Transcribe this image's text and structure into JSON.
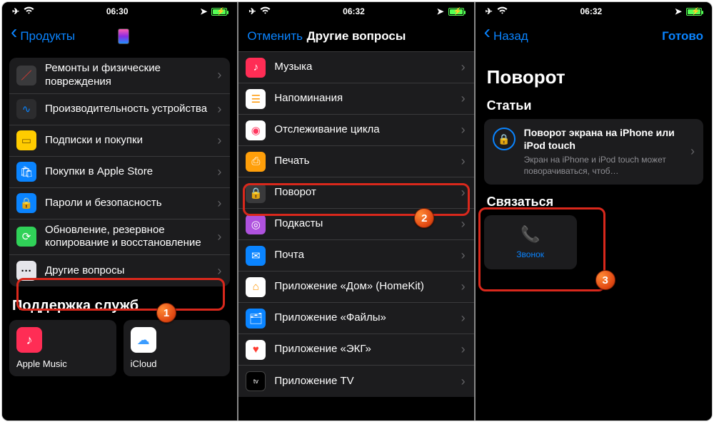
{
  "screen1": {
    "status": {
      "time": "06:30"
    },
    "back_label": "Продукты",
    "topics": [
      {
        "label": "Ремонты и физические повреждения",
        "icon": "screwdriver-icon",
        "bg": "#3a3a3c",
        "glyph": "🛠"
      },
      {
        "label": "Производительность устройства",
        "icon": "activity-icon",
        "bg": "#3a3a3c",
        "glyph": "〰"
      },
      {
        "label": "Подписки и покупки",
        "icon": "wallet-icon",
        "bg": "#ffcc00",
        "glyph": "💳"
      },
      {
        "label": "Покупки в Apple Store",
        "icon": "bag-icon",
        "bg": "#0a84ff",
        "glyph": "🛍"
      },
      {
        "label": "Пароли и безопасность",
        "icon": "lock-icon",
        "bg": "#0a84ff",
        "glyph": "🔒"
      },
      {
        "label": "Обновление, резервное копирование и восстановление",
        "icon": "backup-icon",
        "bg": "#30d158",
        "glyph": "⟳"
      },
      {
        "label": "Другие вопросы",
        "icon": "more-icon",
        "bg": "#e5e5ea",
        "glyph": "···"
      }
    ],
    "services_header": "Поддержка служб",
    "services": [
      {
        "label": "Apple Music",
        "bg": "#ff2d55",
        "glyph": "♪"
      },
      {
        "label": "iCloud",
        "bg": "#ffffff",
        "glyph": "☁"
      }
    ]
  },
  "screen2": {
    "status": {
      "time": "06:32"
    },
    "cancel": "Отменить",
    "title": "Другие вопросы",
    "items": [
      {
        "label": "Музыка",
        "bg": "#ff2d55",
        "glyph": "♪"
      },
      {
        "label": "Напоминания",
        "bg": "#ffffff",
        "glyph": "☰"
      },
      {
        "label": "Отслеживание цикла",
        "bg": "#ffffff",
        "glyph": "◉"
      },
      {
        "label": "Печать",
        "bg": "#ff9f0a",
        "glyph": "⎙"
      },
      {
        "label": "Поворот",
        "bg": "#3a3a3c",
        "glyph": "🔒"
      },
      {
        "label": "Подкасты",
        "bg": "#af52de",
        "glyph": "◎"
      },
      {
        "label": "Почта",
        "bg": "#0a84ff",
        "glyph": "✉"
      },
      {
        "label": "Приложение «Дом» (HomeKit)",
        "bg": "#ffffff",
        "glyph": "🏠"
      },
      {
        "label": "Приложение «Файлы»",
        "bg": "#0a84ff",
        "glyph": "📁"
      },
      {
        "label": "Приложение «ЭКГ»",
        "bg": "#ffffff",
        "glyph": "♥"
      },
      {
        "label": "Приложение TV",
        "bg": "#000000",
        "glyph": "tv"
      }
    ]
  },
  "screen3": {
    "status": {
      "time": "06:32"
    },
    "back": "Назад",
    "done": "Готово",
    "page_title": "Поворот",
    "articles_header": "Статьи",
    "article": {
      "title": "Поворот экрана на iPhone или iPod touch",
      "sub": "Экран на iPhone и iPod touch может поворачиваться, чтоб…"
    },
    "contact_header": "Связаться",
    "contact_label": "Звонок"
  },
  "callouts": {
    "n1": "1",
    "n2": "2",
    "n3": "3"
  }
}
